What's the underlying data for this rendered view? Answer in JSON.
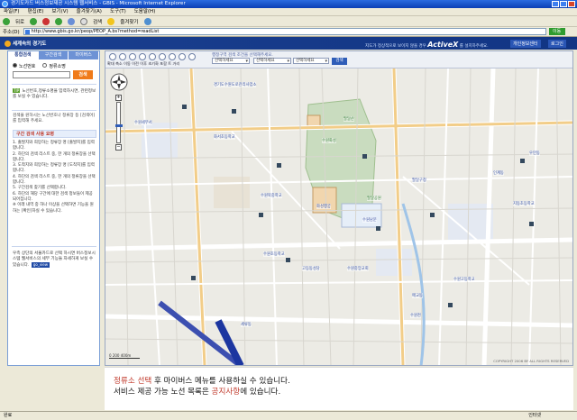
{
  "window": {
    "title": "경기도카드 버스정보제공 시스템 웹서비스 - GBIS - Microsoft Internet Explorer"
  },
  "menu": [
    "파일(F)",
    "편집(E)",
    "보기(V)",
    "즐겨찾기(A)",
    "도구(T)",
    "도움말(H)"
  ],
  "toolbar": {
    "back": "뒤로",
    "search": "검색",
    "favorites": "즐겨찾기"
  },
  "address": {
    "label": "주소(D)",
    "url": "http://www.gbis.go.kr/peop/PEOP_A.bs?method=readList",
    "go": "이동"
  },
  "site": {
    "logo": "세계속의 경기도",
    "activex_prefix": "지도가 정상적으로 보이지 않을 경우",
    "activex_word": "ActiveX",
    "activex_suffix": "를 설치하주세요.",
    "link1": "개인정보센터",
    "link2": "로그인"
  },
  "sidebar": {
    "tabs": [
      "통합검색",
      "구간검색",
      "마이버스"
    ],
    "radio": [
      "노선번호",
      "정류소명"
    ],
    "search_button": "검색",
    "tip_tag": "TIP",
    "tip": "노선번호,정류소명을 입력하시면, 관련정보를 보실 수 있습니다.",
    "intro": "검색을 원하시는 노선번호나 정류장 등 [검색어]를 입력해 주세요.",
    "guide_title": "구간 검색 사용 요령",
    "steps": [
      "1. 출발지와 희망하는 정류장 명 [출발지]를 입력합니다.",
      "2. 하단의 검색 리스트 중, 한 개의 정류장을 선택 합니다.",
      "3. 도착지와 희망하는 정류장 명 [도착지]를 입력합니다.",
      "4. 하단의 검색 리스트 중, 한 개의 정류장을 선택 합니다.",
      "5. 구간검색 찾기를 선택합니다.",
      "6. 하단의 해당 구간에 대한 검색 정보들이 제공 되어집니다.",
      "※ 이래 내역 중 하나 이상을 선택하면 기능을 원하는 [확인]하실 수 있습니다."
    ],
    "bottom_note": "우측 상단의 서울카드로 선택 하시면 버스정보시스템 웹서비스의 세부 기능들 자세하게 보실 수 있습니다.",
    "more": "go_view"
  },
  "map": {
    "tools": [
      "확대",
      "축소",
      "이동",
      "이전",
      "이후",
      "초기화",
      "포함",
      "트",
      "거리"
    ],
    "region_label": "행정구역 검색 조건을 선택해주세요.",
    "selects": [
      "선택하세요",
      "선택하세요",
      "선택하세요"
    ],
    "search": "검색",
    "labels": [
      {
        "t": "경기도수원도로관리사업소",
        "c": "blue"
      },
      {
        "t": "수원세무서",
        "c": "blue"
      },
      {
        "t": "팔달산",
        "c": "green"
      },
      {
        "t": "수원화성",
        "c": "green"
      },
      {
        "t": "화성행궁",
        "c": "blue"
      },
      {
        "t": "팔달구청",
        "c": "blue"
      },
      {
        "t": "수원남문",
        "c": "blue"
      },
      {
        "t": "팔달공원",
        "c": "green"
      },
      {
        "t": "화서초등학교",
        "c": "blue"
      },
      {
        "t": "수원북중학교",
        "c": "blue"
      },
      {
        "t": "수원초등학교",
        "c": "blue"
      },
      {
        "t": "고등동성당",
        "c": "blue"
      },
      {
        "t": "수원중앙교회",
        "c": "blue"
      },
      {
        "t": "지동초등학교",
        "c": "blue"
      },
      {
        "t": "수원고등학교",
        "c": "blue"
      },
      {
        "t": "세류동",
        "c": "blue"
      },
      {
        "t": "수원천",
        "c": "blue"
      },
      {
        "t": "매교동",
        "c": "blue"
      },
      {
        "t": "인계동",
        "c": "blue"
      },
      {
        "t": "우만동",
        "c": "blue"
      }
    ],
    "scale": "0 200 400m",
    "copyright": "COPYRIGHT 2006 BY ALL RIGHTS RESERVED"
  },
  "notice": {
    "line1_red": "정류소 선택",
    "line1_rest": " 후 마이버스 메뉴를 사용하실 수 있습니다.",
    "line2_pre": "서비스 제공 가능 노선 목록은 ",
    "line2_red": "공지사항",
    "line2_post": "에 있습니다."
  },
  "status": {
    "left": "완료",
    "zone": "인터넷"
  }
}
